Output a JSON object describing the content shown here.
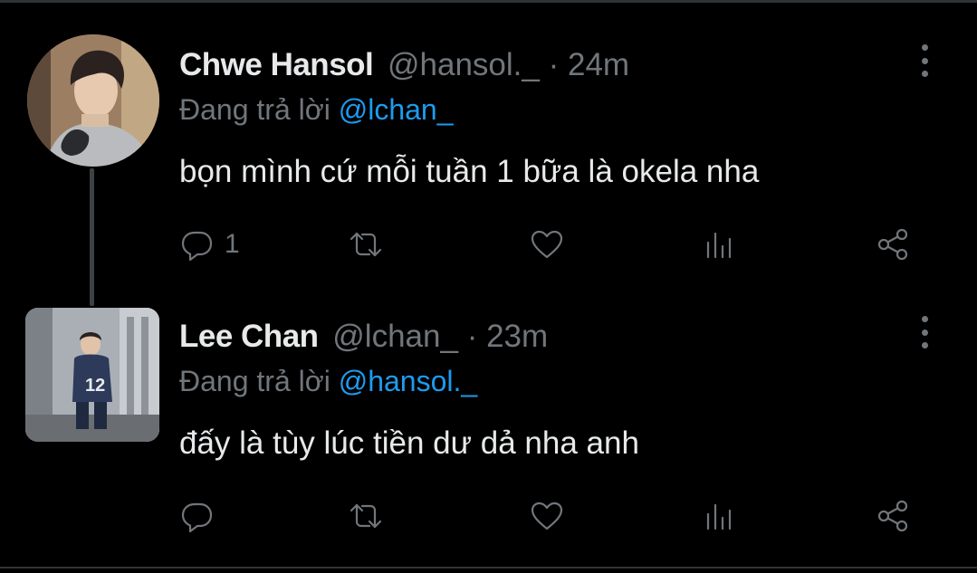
{
  "tweets": [
    {
      "display_name": "Chwe Hansol",
      "handle": "@hansol._",
      "separator": "·",
      "time": "24m",
      "reply_prefix": "Đang trả lời",
      "reply_to": "@lchan_",
      "text": "bọn mình cứ mỗi tuần 1 bữa là okela nha",
      "reply_count": "1"
    },
    {
      "display_name": "Lee Chan",
      "handle": "@lchan_",
      "separator": "·",
      "time": "23m",
      "reply_prefix": "Đang trả lời",
      "reply_to": "@hansol._",
      "text": "đấy là tùy lúc tiền dư dả nha anh",
      "reply_count": ""
    }
  ],
  "icons": {
    "reply": "reply-icon",
    "retweet": "retweet-icon",
    "like": "heart-icon",
    "views": "views-icon",
    "share": "share-icon",
    "more": "more-vertical-icon"
  },
  "colors": {
    "background": "#000000",
    "primary_text": "#e7e9ea",
    "secondary_text": "#71767b",
    "accent": "#1d9bf0",
    "divider": "#2f3336"
  }
}
